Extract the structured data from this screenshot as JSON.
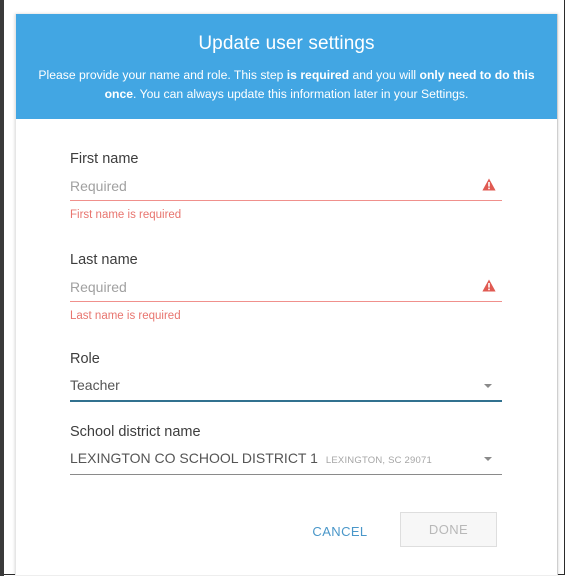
{
  "dialog": {
    "title": "Update user settings",
    "description": {
      "part1": "Please provide your name and role. This step ",
      "bold1": "is required",
      "part2": " and you will ",
      "bold2": "only need to do this once",
      "part3": ". You can always update this information later in your Settings."
    }
  },
  "form": {
    "first_name": {
      "label": "First name",
      "placeholder": "Required",
      "value": "",
      "error": "First name is required",
      "icon": "warning-icon"
    },
    "last_name": {
      "label": "Last name",
      "placeholder": "Required",
      "value": "",
      "error": "Last name is required",
      "icon": "warning-icon"
    },
    "role": {
      "label": "Role",
      "value": "Teacher",
      "icon": "chevron-down-icon"
    },
    "school_district": {
      "label": "School district name",
      "value": "LEXINGTON CO SCHOOL DISTRICT 1",
      "sublabel": "LEXINGTON, SC 29071",
      "icon": "chevron-down-icon"
    }
  },
  "actions": {
    "cancel_label": "CANCEL",
    "done_label": "DONE"
  },
  "colors": {
    "header_bg": "#42a6e3",
    "error": "#e8756f",
    "active_underline": "#31718f",
    "cancel_text": "#4a97c9"
  }
}
